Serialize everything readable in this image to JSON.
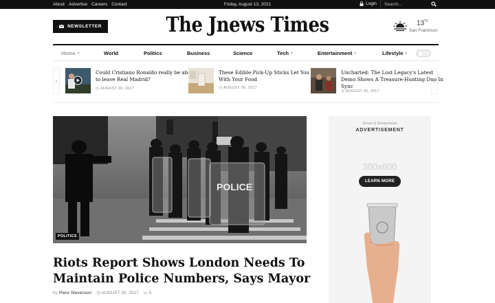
{
  "topbar": {
    "links": [
      "About",
      "Advertise",
      "Careers",
      "Contact"
    ],
    "date": "Friday, August 13, 2021",
    "login_label": "Login",
    "search_placeholder": "Search..."
  },
  "header": {
    "newsletter_label": "NEWSLETTER",
    "logo_text": "The Jnews Times",
    "weather": {
      "temp": "13",
      "unit": "°C",
      "city": "San Francisco"
    }
  },
  "nav": {
    "items": [
      {
        "label": "Home",
        "dropdown": true,
        "active": true
      },
      {
        "label": "World",
        "dropdown": false
      },
      {
        "label": "Politics",
        "dropdown": false
      },
      {
        "label": "Business",
        "dropdown": false
      },
      {
        "label": "Science",
        "dropdown": false
      },
      {
        "label": "Tech",
        "dropdown": true
      },
      {
        "label": "Entertainment",
        "dropdown": true
      },
      {
        "label": "Lifestyle",
        "dropdown": true
      }
    ]
  },
  "carousel": {
    "items": [
      {
        "title": "Could Cristiano Ronaldo really be about to leave Real Madrid?",
        "date": "AUGUST 30, 2017"
      },
      {
        "title": "These Edible Pick-Up Sticks Let You Play With Your Food",
        "date": "AUGUST 30, 2017"
      },
      {
        "title": "Uncharted: The Lost Legacy's Latest Demo Shows A Treasure-Hunting Duo In Sync",
        "date": "AUGUST 30, 2017"
      }
    ]
  },
  "hero": {
    "category": "POLITICS",
    "headline": "Riots Report Shows London Needs To Maintain Police Numbers, Says Mayor",
    "by": "by",
    "author": "Piere Stevenson",
    "date": "AUGUST 30, 2017",
    "comments": "5",
    "shield_text": "POLICE"
  },
  "ad": {
    "small_text": "Smart & Responsive",
    "label": "ADVERTISEMENT",
    "size": "300x600",
    "button": "LEARN MORE"
  },
  "colors": {
    "dark": "#111111",
    "muted": "#888888",
    "accent_bg": "#f4f4f4"
  }
}
